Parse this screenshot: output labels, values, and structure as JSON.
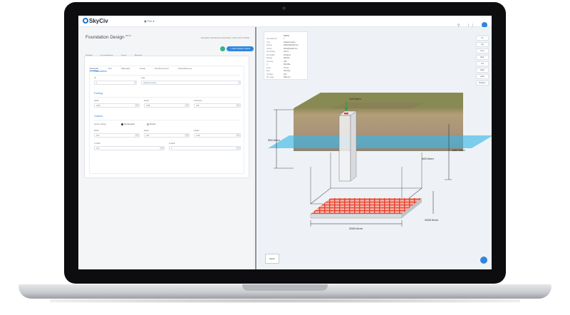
{
  "app": {
    "logo_text": "SkyCiv",
    "file_menu": "File",
    "title": "Foundation Design",
    "title_badge": "BETA",
    "standard": "Canadian Standards Association (CSA A23.3-2019)",
    "add_button": "+ New Design Check"
  },
  "nav_tabs": [
    "Details",
    "Foundations",
    "Input",
    "Results"
  ],
  "sub_tabs": [
    "Geometry",
    "Soil",
    "Materials",
    "Loads",
    "Reinforcement",
    "Miscellaneous"
  ],
  "geometry": {
    "foundation_heading": "Foundation",
    "id_label": "ID",
    "id_value": "1",
    "type_label": "Type",
    "type_value": "Isolated Footing",
    "footing_heading": "Footing",
    "width_label": "Width",
    "width_value": "2000",
    "depth_label": "Depth",
    "depth_value": "2000",
    "thickness_label": "Thickness",
    "thickness_value": "300",
    "unit_mm": "mm",
    "column_heading": "Column",
    "section_shape_label": "Section Shape",
    "shape_rect": "Rectangular",
    "shape_round": "Round",
    "col_width_label": "Width",
    "col_width_value": "400",
    "col_depth_label": "Depth",
    "col_depth_value": "400",
    "height_label": "Height",
    "height_value": "1200",
    "x_offset_label": "X-offset",
    "x_offset_value": "100",
    "z_offset_label": "Z-offset",
    "z_offset_value": "0"
  },
  "info": {
    "heading": "DATA",
    "rows": [
      [
        "Foundation ID",
        "1"
      ],
      [
        "Type",
        "Isolated Footing"
      ],
      [
        "Footing",
        "2000x2000x300 mm"
      ],
      [
        "Column",
        "400x400x1200 mm"
      ],
      [
        "Soil Surface",
        "0.00 m"
      ],
      [
        "Soil Weight",
        "18 kN/m3"
      ],
      [
        "Bearing",
        "200 kPa"
      ],
      [
        "Concrete",
        "C25"
      ],
      [
        "fy",
        "500 MPa"
      ],
      [
        "Cover",
        "75 mm"
      ],
      [
        "Bars",
        "N12 bars"
      ],
      [
        "Top Bars",
        "N12"
      ],
      [
        "Dir. image",
        "2000 mm"
      ]
    ]
  },
  "view_buttons": [
    "Iso",
    "Top",
    "Front",
    "Back",
    "Left",
    "Right",
    "Under",
    "Rotation"
  ],
  "dimensions": {
    "left_height": "900.0mm",
    "right_height": "1150.0mm",
    "depth": "2000.0mm",
    "width": "2000.0mm",
    "col_label": "100.0mm",
    "side_small": "400.0mm"
  },
  "axis_label": "SkyCiv",
  "colors": {
    "accent": "#2d86e0",
    "soil": "#a99672",
    "water": "#3fb7e6",
    "rebar": "#e8402f"
  }
}
